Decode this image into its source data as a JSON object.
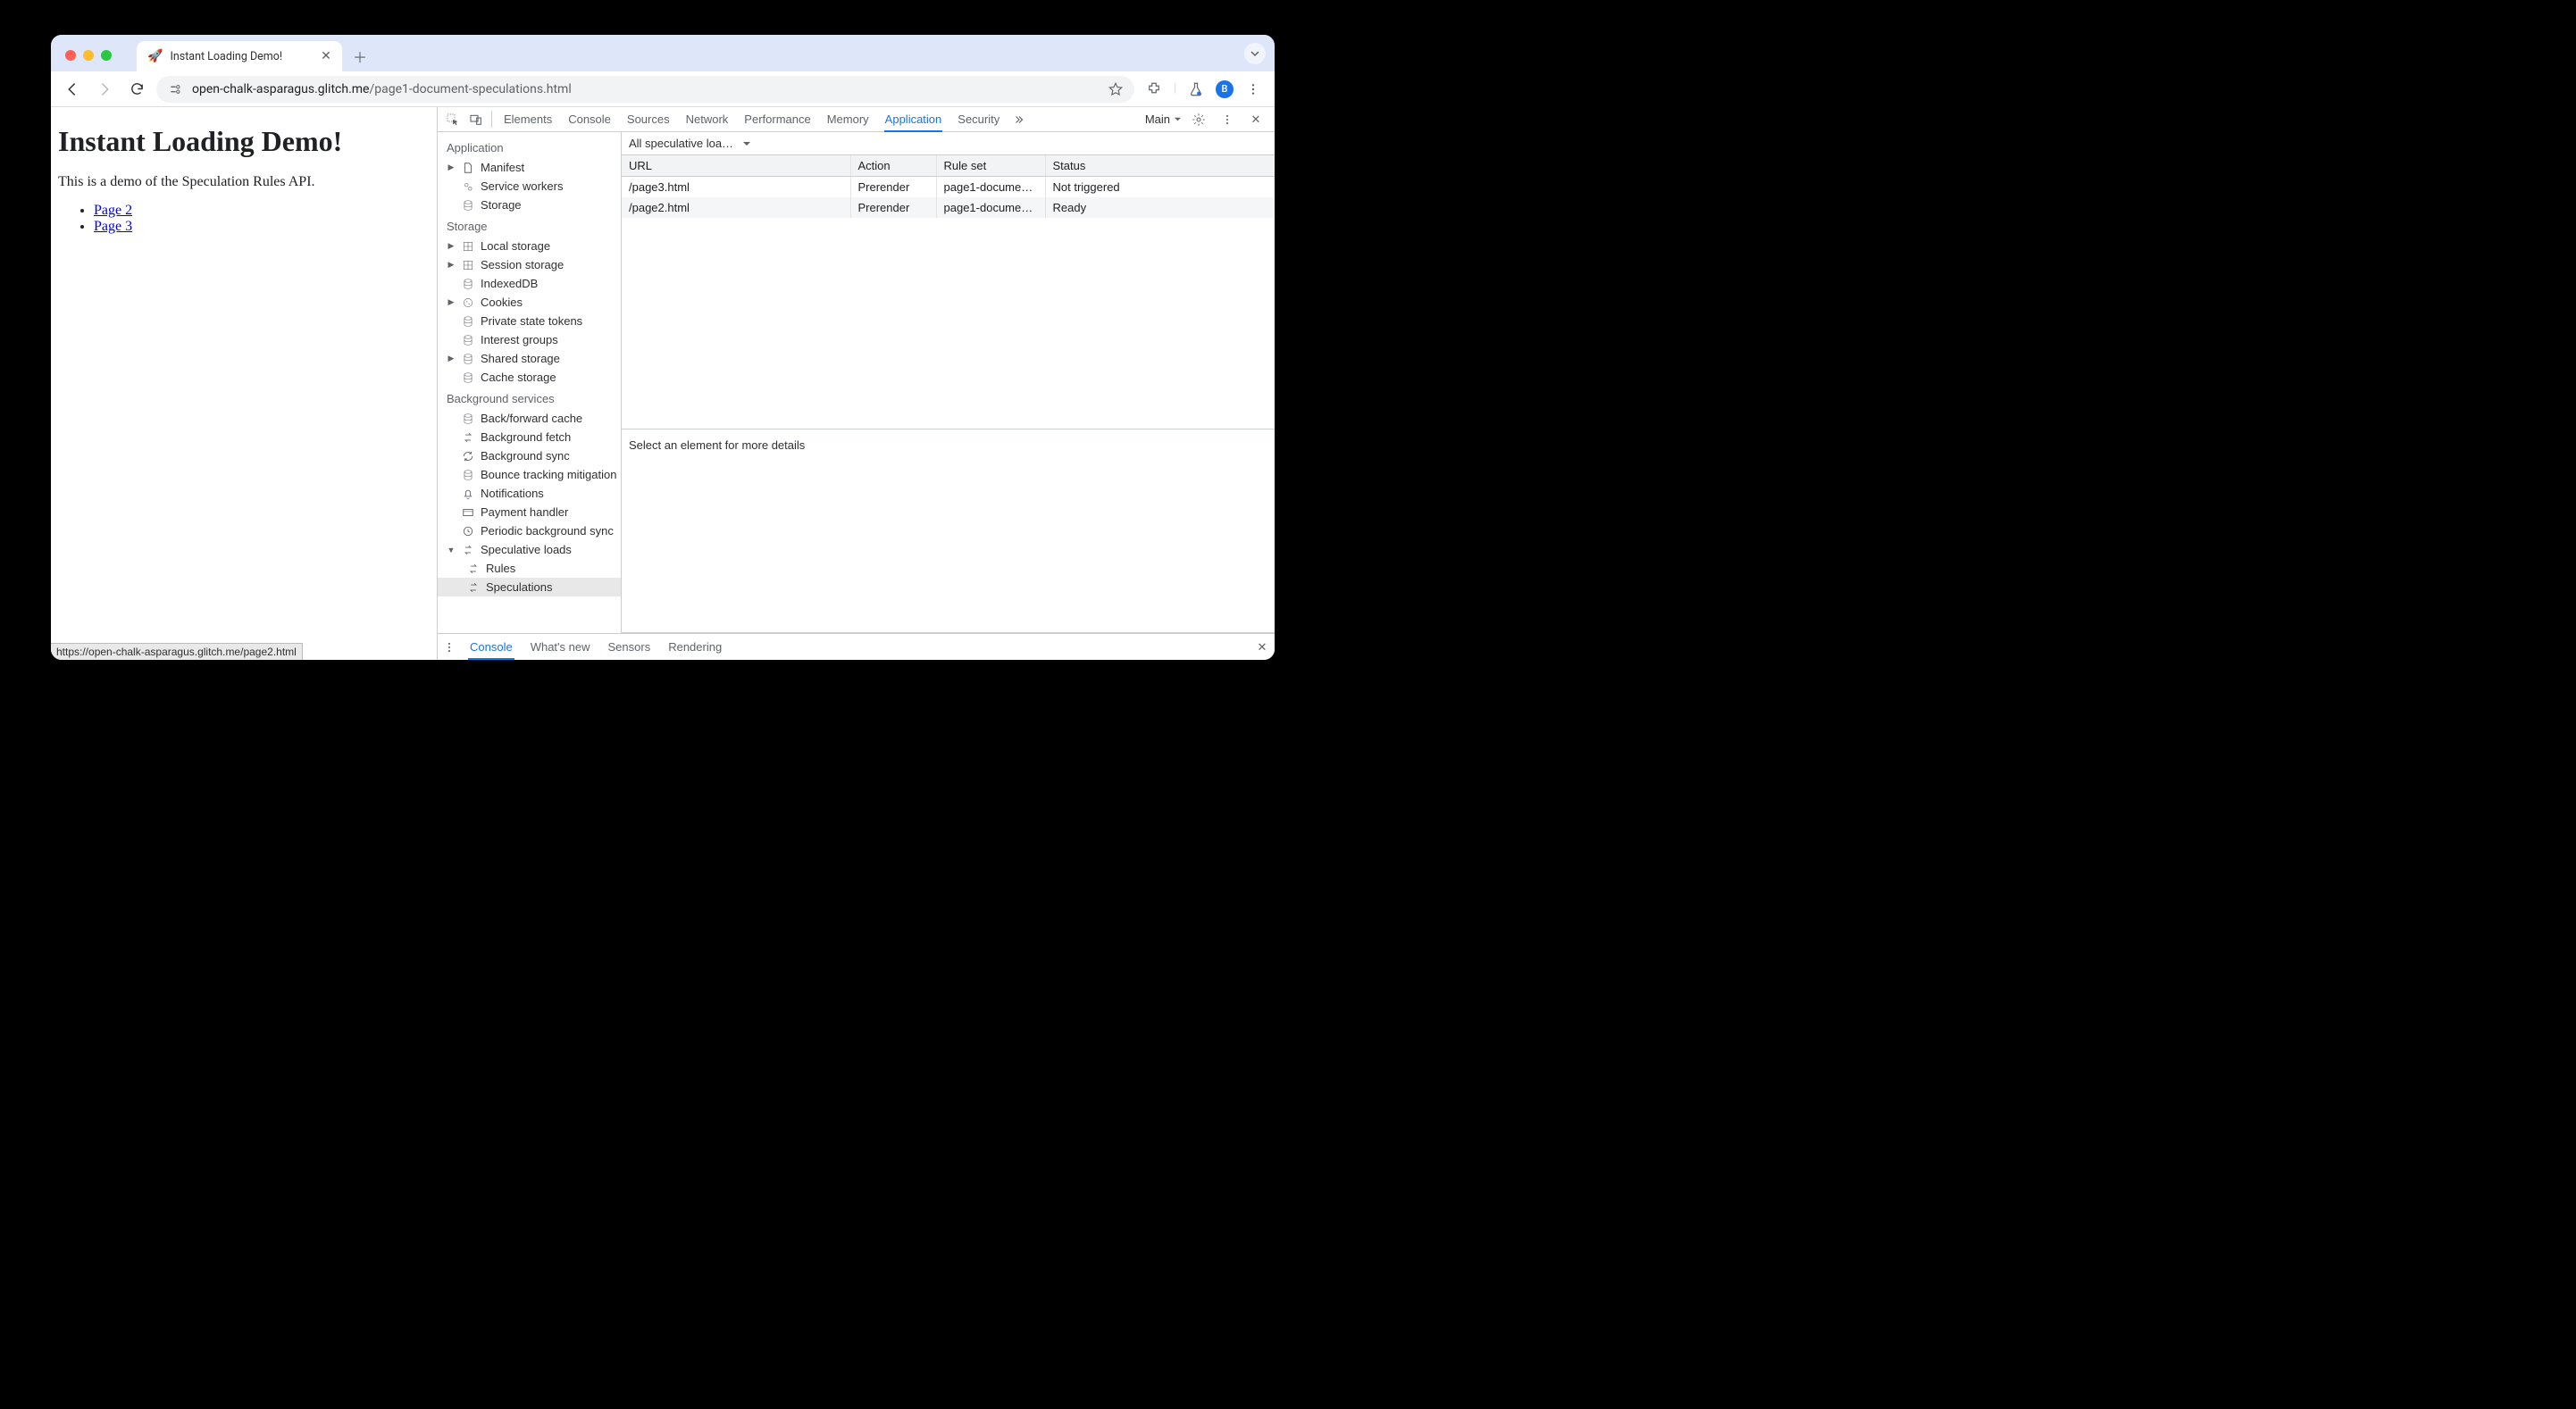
{
  "tab": {
    "title": "Instant Loading Demo!",
    "favicon": "🚀"
  },
  "omnibox": {
    "host": "open-chalk-asparagus.glitch.me",
    "path": "/page1-document-speculations.html"
  },
  "avatar_letter": "B",
  "target_label": "Main",
  "page": {
    "heading": "Instant Loading Demo!",
    "intro": "This is a demo of the Speculation Rules API.",
    "links": [
      "Page 2",
      "Page 3"
    ]
  },
  "status_bar": "https://open-chalk-asparagus.glitch.me/page2.html",
  "devtools_tabs": [
    "Elements",
    "Console",
    "Sources",
    "Network",
    "Performance",
    "Memory",
    "Application",
    "Security"
  ],
  "devtools_active_tab": "Application",
  "sidebar": {
    "groups": [
      {
        "label": "Application",
        "items": [
          {
            "label": "Manifest",
            "icon": "file",
            "expandable": true
          },
          {
            "label": "Service workers",
            "icon": "gears"
          },
          {
            "label": "Storage",
            "icon": "db"
          }
        ]
      },
      {
        "label": "Storage",
        "items": [
          {
            "label": "Local storage",
            "icon": "grid",
            "expandable": true
          },
          {
            "label": "Session storage",
            "icon": "grid",
            "expandable": true
          },
          {
            "label": "IndexedDB",
            "icon": "db"
          },
          {
            "label": "Cookies",
            "icon": "cookie",
            "expandable": true
          },
          {
            "label": "Private state tokens",
            "icon": "db"
          },
          {
            "label": "Interest groups",
            "icon": "db"
          },
          {
            "label": "Shared storage",
            "icon": "db",
            "expandable": true
          },
          {
            "label": "Cache storage",
            "icon": "db"
          }
        ]
      },
      {
        "label": "Background services",
        "items": [
          {
            "label": "Back/forward cache",
            "icon": "db"
          },
          {
            "label": "Background fetch",
            "icon": "swap"
          },
          {
            "label": "Background sync",
            "icon": "sync"
          },
          {
            "label": "Bounce tracking mitigation",
            "icon": "db"
          },
          {
            "label": "Notifications",
            "icon": "bell"
          },
          {
            "label": "Payment handler",
            "icon": "card"
          },
          {
            "label": "Periodic background sync",
            "icon": "clock"
          },
          {
            "label": "Speculative loads",
            "icon": "swap",
            "expandable": true,
            "expanded": true,
            "children": [
              {
                "label": "Rules",
                "icon": "swap"
              },
              {
                "label": "Speculations",
                "icon": "swap",
                "selected": true
              }
            ]
          }
        ]
      }
    ]
  },
  "filter_label": "All speculative loa…",
  "table": {
    "columns": [
      "URL",
      "Action",
      "Rule set",
      "Status"
    ],
    "rows": [
      {
        "url": "/page3.html",
        "action": "Prerender",
        "ruleset": "page1-document-…",
        "status": "Not triggered"
      },
      {
        "url": "/page2.html",
        "action": "Prerender",
        "ruleset": "page1-document-…",
        "status": "Ready"
      }
    ]
  },
  "details_placeholder": "Select an element for more details",
  "drawer_tabs": [
    "Console",
    "What's new",
    "Sensors",
    "Rendering"
  ],
  "drawer_active": "Console"
}
